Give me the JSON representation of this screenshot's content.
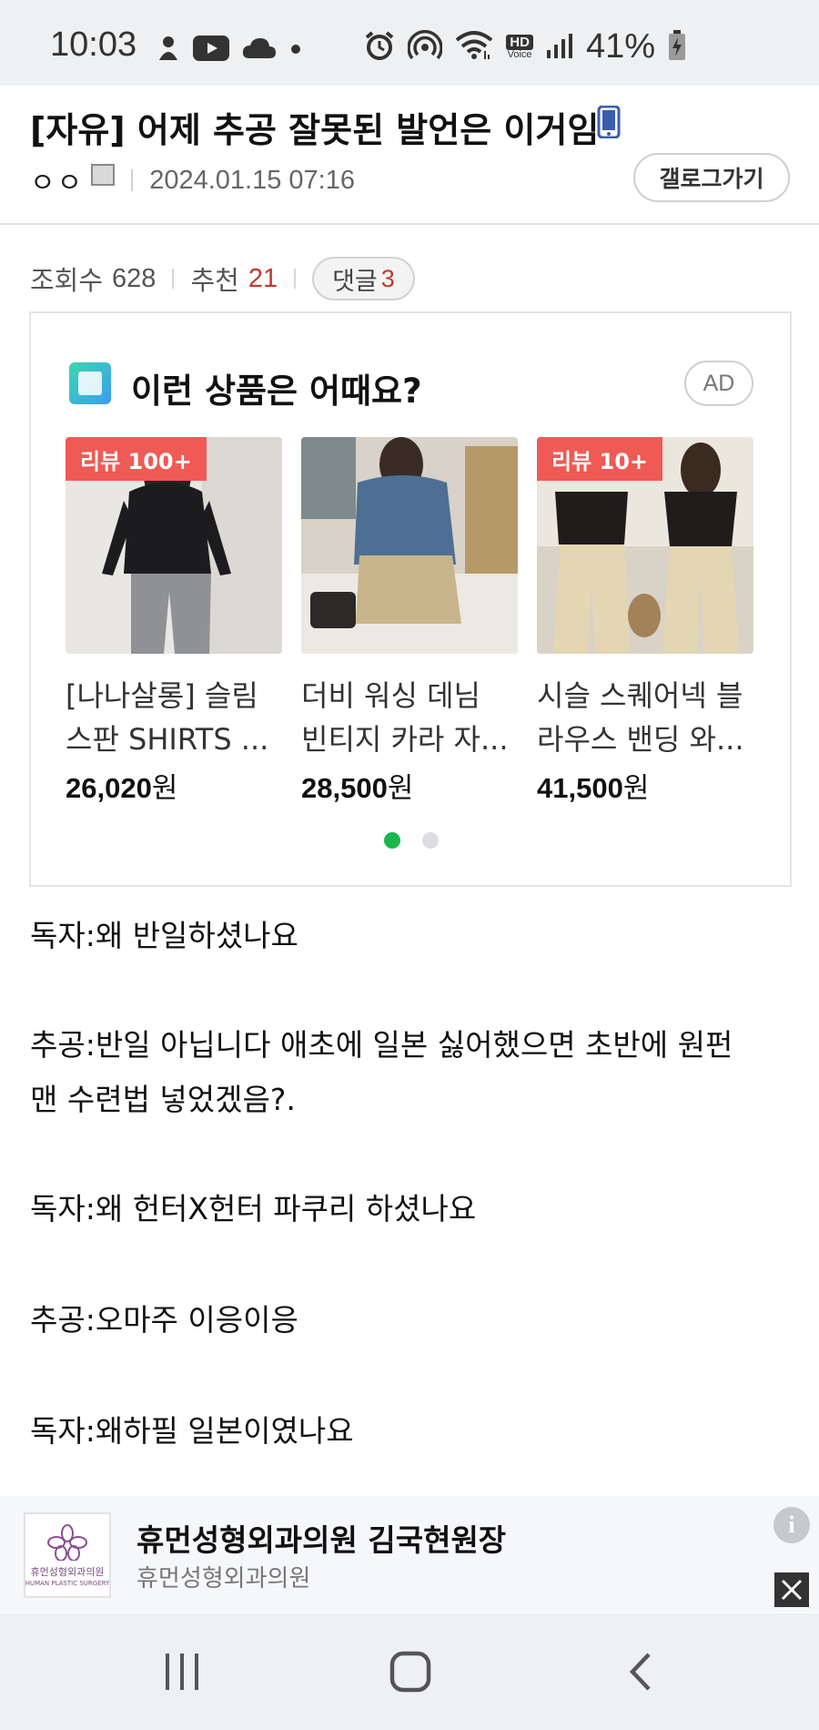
{
  "status_bar": {
    "time": "10:03",
    "battery_percent": "41%",
    "icons": [
      "person-notification-icon",
      "youtube-icon",
      "cloud-icon",
      "dot-icon",
      "alarm-icon",
      "hotspot-icon",
      "wifi-icon",
      "hd-voice-icon",
      "signal-icon",
      "battery-charging-icon"
    ],
    "hd_label": "HD",
    "voice_label": "Voice"
  },
  "post": {
    "title": "[자유] 어제 추공 잘못된 발언은 이거임",
    "author": "ㅇㅇ",
    "date": "2024.01.15 07:16",
    "gallery_button": "갤로그가기"
  },
  "stats": {
    "views_label": "조회수",
    "views": "628",
    "recommend_label": "추천",
    "recommend": "21",
    "comments_label": "댓글",
    "comments": "3"
  },
  "ad_box": {
    "heading": "이런 상품은 어때요?",
    "badge": "AD",
    "products": [
      {
        "tag": "리뷰 100+",
        "name_line1": "[나나살롱] 슬림",
        "name_line2": "스판 SHIRTS ...",
        "price": "26,020",
        "currency": "원"
      },
      {
        "tag": "",
        "name_line1": "더비 워싱 데님",
        "name_line2": "빈티지 카라 자...",
        "price": "28,500",
        "currency": "원"
      },
      {
        "tag": "리뷰 10+",
        "name_line1": "시슬 스퀘어넥 블",
        "name_line2": "라우스 밴딩 와...",
        "price": "41,500",
        "currency": "원"
      }
    ],
    "page_indicator": {
      "active": 1,
      "total": 2
    }
  },
  "content": {
    "lines": [
      "독자:왜 반일하셨나요",
      "",
      "추공:반일 아닙니다 애초에 일본 싫어했으면 초반에 원펀",
      "맨 수련법 넣었겠음?.",
      "",
      "독자:왜 헌터X헌터 파쿠리 하셨나요",
      "",
      "추공:오마주 이응이응",
      "",
      "독자:왜하필 일본이였나요"
    ]
  },
  "bottom_ad": {
    "title": "휴먼성형외과의원 김국현원장",
    "subtitle": "휴먼성형외과의원",
    "logo_text": "휴먼성형외과의원",
    "logo_subtext": "HUMAN PLASTIC SURGERY"
  },
  "navbar": {
    "buttons": [
      "recents-icon",
      "home-icon",
      "back-icon"
    ]
  },
  "colors": {
    "accent_red": "#c0392b",
    "tag_red": "#ef5a55",
    "dot_active": "#19b84a"
  }
}
